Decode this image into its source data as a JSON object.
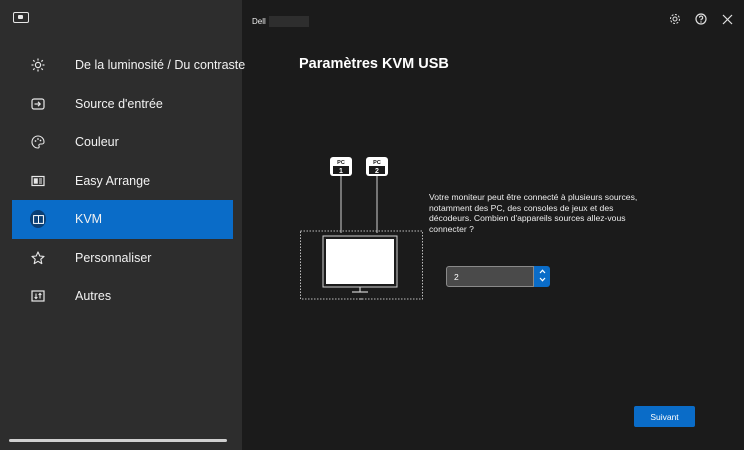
{
  "app": {
    "monitor_name": "Dell",
    "icons": {
      "logo": "monitor-logo-icon",
      "settings": "gear-icon",
      "help": "help-icon",
      "close": "close-icon"
    }
  },
  "sidebar": {
    "items": [
      {
        "label": "De la luminosité / Du contraste",
        "icon": "brightness-icon",
        "active": false
      },
      {
        "label": "Source d'entrée",
        "icon": "input-source-icon",
        "active": false
      },
      {
        "label": "Couleur",
        "icon": "palette-icon",
        "active": false
      },
      {
        "label": "Easy Arrange",
        "icon": "layout-icon",
        "active": false
      },
      {
        "label": "KVM",
        "icon": "kvm-icon",
        "active": true
      },
      {
        "label": "Personnaliser",
        "icon": "star-icon",
        "active": false
      },
      {
        "label": "Autres",
        "icon": "others-icon",
        "active": false
      }
    ]
  },
  "main": {
    "title": "Paramètres KVM USB",
    "diagram": {
      "pc1_top": "PC",
      "pc1_num": "1",
      "pc2_top": "PC",
      "pc2_num": "2"
    },
    "description": "Votre moniteur peut être connecté à plusieurs sources, notamment des PC, des consoles de jeux et des décodeurs. Combien d'appareils sources allez-vous connecter ?",
    "select": {
      "value": "2"
    },
    "next_label": "Suivant"
  },
  "colors": {
    "accent": "#0a6cc8",
    "sidebar_bg": "#2d2d2d",
    "main_bg": "#1b1b1b"
  }
}
